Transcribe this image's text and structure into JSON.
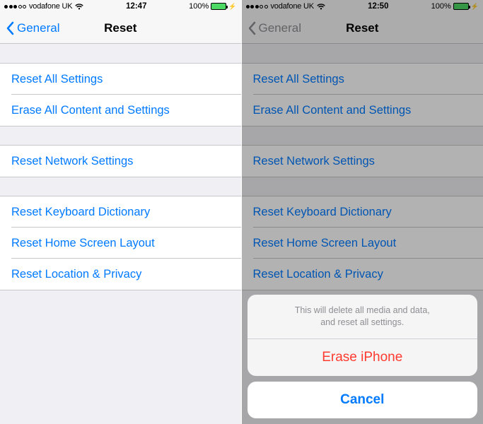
{
  "left": {
    "status": {
      "signal_filled": 3,
      "signal_total": 5,
      "carrier": "vodafone UK",
      "time": "12:47",
      "battery_pct": "100%"
    },
    "nav": {
      "back_label": "General",
      "title": "Reset"
    },
    "groups": [
      [
        {
          "label": "Reset All Settings"
        },
        {
          "label": "Erase All Content and Settings"
        }
      ],
      [
        {
          "label": "Reset Network Settings"
        }
      ],
      [
        {
          "label": "Reset Keyboard Dictionary"
        },
        {
          "label": "Reset Home Screen Layout"
        },
        {
          "label": "Reset Location & Privacy"
        }
      ]
    ]
  },
  "right": {
    "status": {
      "signal_filled": 3,
      "signal_total": 5,
      "carrier": "vodafone UK",
      "time": "12:50",
      "battery_pct": "100%"
    },
    "nav": {
      "back_label": "General",
      "title": "Reset"
    },
    "groups": [
      [
        {
          "label": "Reset All Settings"
        },
        {
          "label": "Erase All Content and Settings"
        }
      ],
      [
        {
          "label": "Reset Network Settings"
        }
      ],
      [
        {
          "label": "Reset Keyboard Dictionary"
        },
        {
          "label": "Reset Home Screen Layout"
        },
        {
          "label": "Reset Location & Privacy"
        }
      ]
    ],
    "action_sheet": {
      "message": "This will delete all media and data,\nand reset all settings.",
      "destructive_label": "Erase iPhone",
      "cancel_label": "Cancel"
    }
  }
}
